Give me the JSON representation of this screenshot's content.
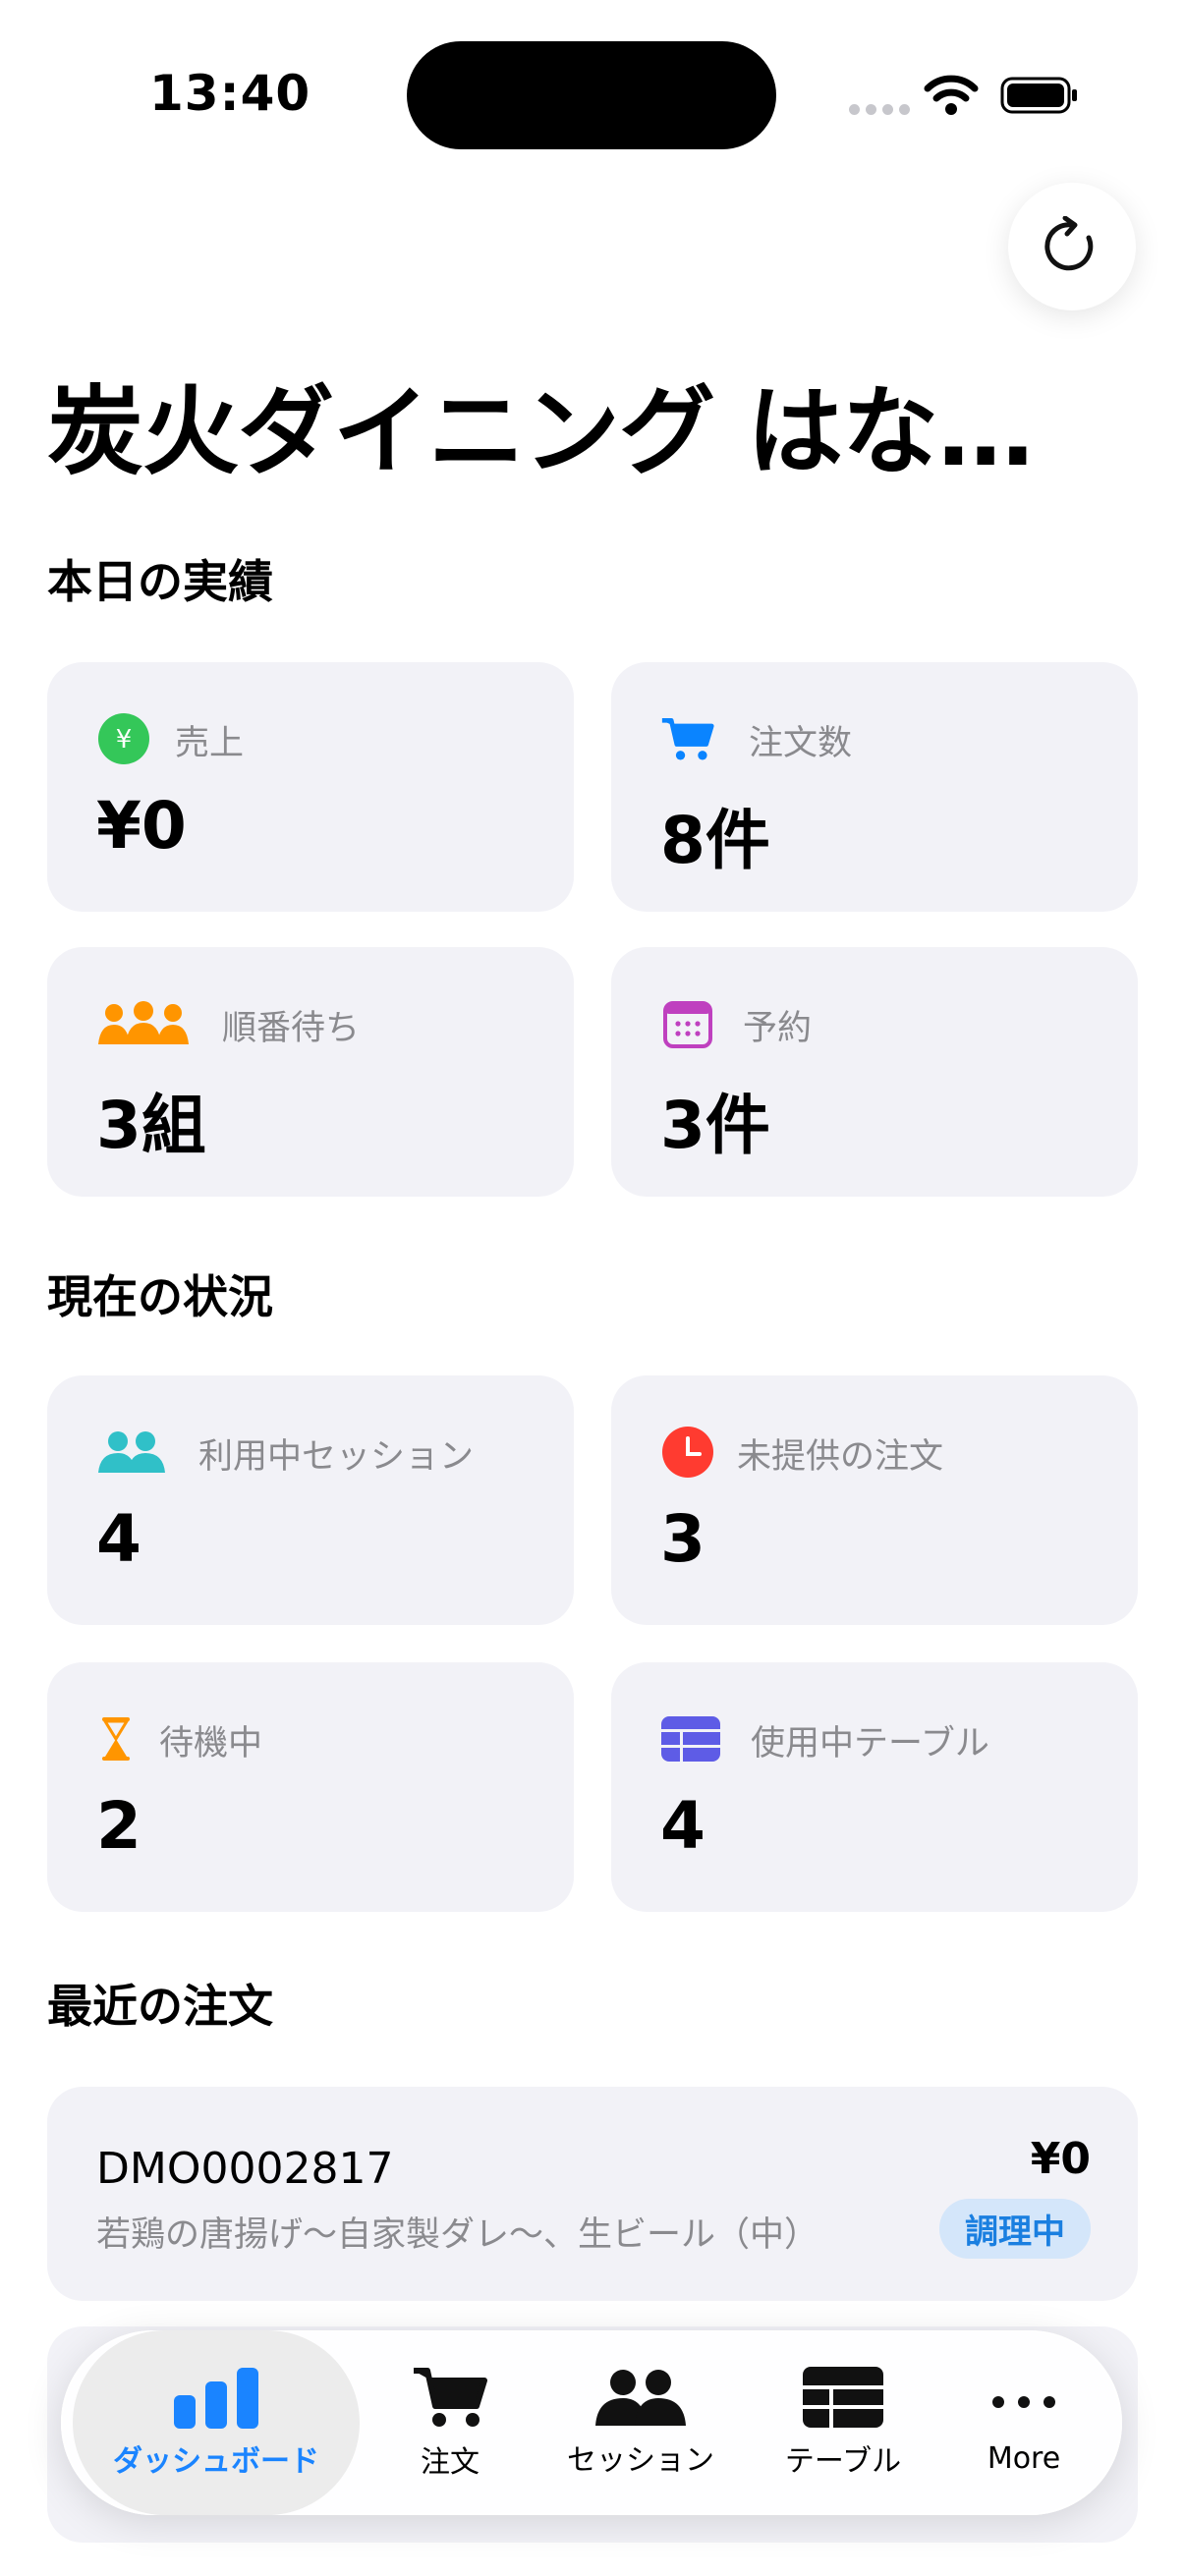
{
  "status_bar": {
    "time": "13:40"
  },
  "header": {
    "title": "炭火ダイニング はな…"
  },
  "sections": {
    "today": "本日の実績",
    "current": "現在の状況",
    "recent_orders": "最近の注文"
  },
  "today_stats": [
    {
      "label": "売上",
      "value": "¥0",
      "icon": "yen-circle-icon",
      "color": "#34c759"
    },
    {
      "label": "注文数",
      "value": "8件",
      "icon": "cart-icon",
      "color": "#0a84ff"
    },
    {
      "label": "順番待ち",
      "value": "3組",
      "icon": "people-group-icon",
      "color": "#ff9500"
    },
    {
      "label": "予約",
      "value": "3件",
      "icon": "calendar-icon",
      "color": "#bf40bf"
    }
  ],
  "current_stats": [
    {
      "label": "利用中セッション",
      "value": "4",
      "icon": "people-icon",
      "color": "#30c0c8"
    },
    {
      "label": "未提供の注文",
      "value": "3",
      "icon": "clock-icon",
      "color": "#ff3b30"
    },
    {
      "label": "待機中",
      "value": "2",
      "icon": "hourglass-icon",
      "color": "#ff9500"
    },
    {
      "label": "使用中テーブル",
      "value": "4",
      "icon": "table-grid-icon",
      "color": "#5e5ce6"
    }
  ],
  "recent_orders": [
    {
      "id": "DMO0002817",
      "items": "若鶏の唐揚げ〜自家製ダレ〜、生ビール（中）",
      "amount": "¥0",
      "status": "調理中"
    }
  ],
  "tabbar": {
    "tabs": [
      {
        "label": "ダッシュボード",
        "icon": "chart-bar-icon",
        "active": true
      },
      {
        "label": "注文",
        "icon": "cart-icon"
      },
      {
        "label": "セッション",
        "icon": "people-icon"
      },
      {
        "label": "テーブル",
        "icon": "table-grid-icon"
      },
      {
        "label": "More",
        "icon": "ellipsis-icon"
      }
    ]
  },
  "colors": {
    "accent": "#1a84ff",
    "card_bg": "#f2f2f7",
    "secondary_text": "#8a8a8e"
  }
}
